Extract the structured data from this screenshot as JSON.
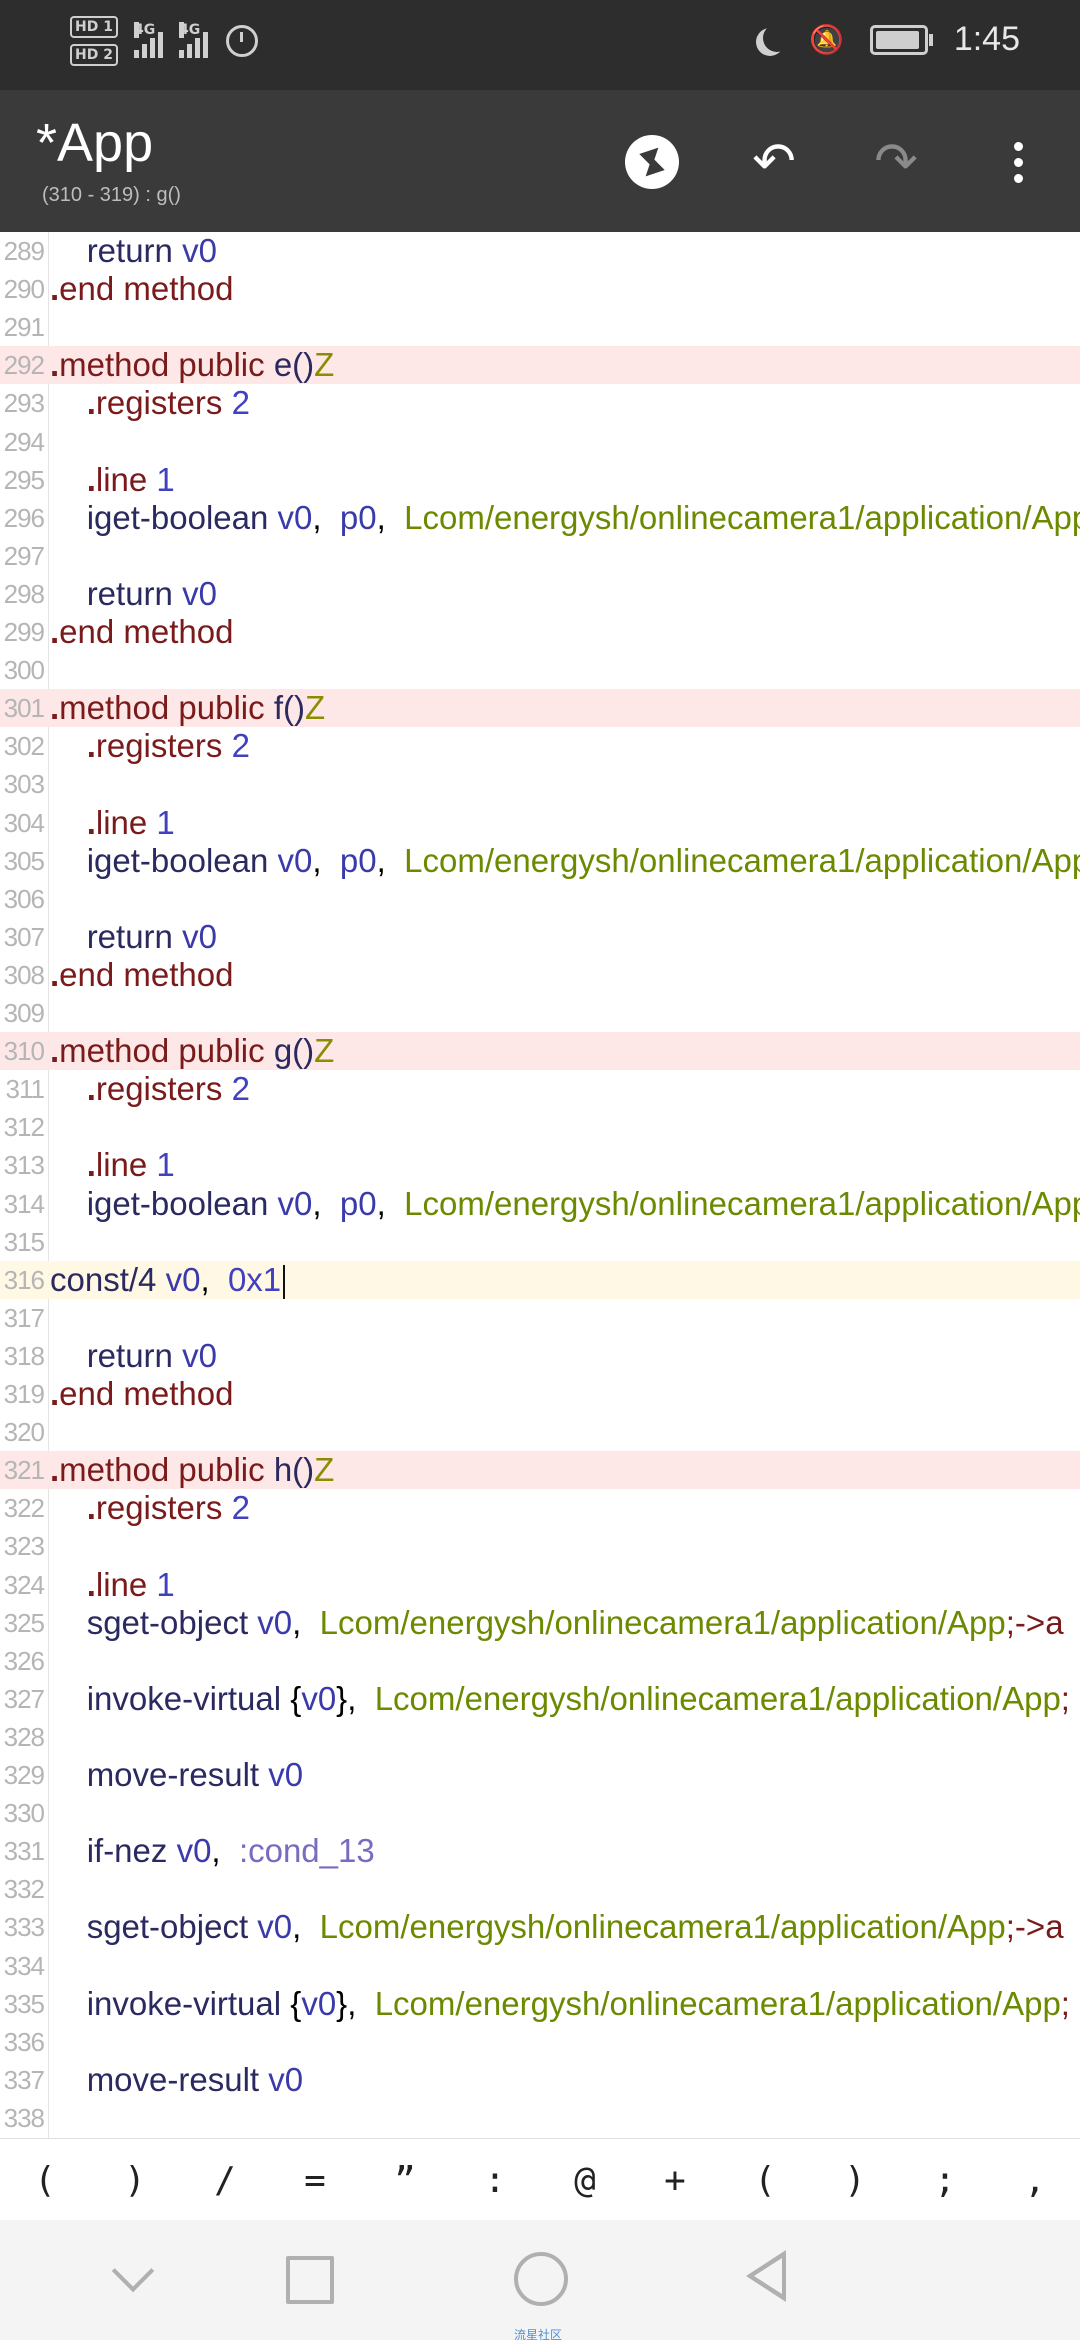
{
  "status_bar": {
    "hd1": "HD 1",
    "hd2": "HD 2",
    "net1": "4G",
    "net2": "4G",
    "time": "1:45"
  },
  "toolbar": {
    "title": "*App",
    "subtitle": "(310 - 319) : g()"
  },
  "editor": {
    "lines": [
      {
        "n": "289",
        "html": "    <span class='kw'>return</span> <span class='reg'>v0</span>"
      },
      {
        "n": "290",
        "html": "<span class='dot'>.</span><span class='dir'>end method</span>"
      },
      {
        "n": "291",
        "html": ""
      },
      {
        "n": "292",
        "html": "<span class='dot'>.</span><span class='dir'>method public</span> <span class='kw'>e()</span><span class='ty'>Z</span>",
        "cls": "method"
      },
      {
        "n": "293",
        "html": "    <span class='dot'>.</span><span class='dir'>registers</span> <span class='num'>2</span>"
      },
      {
        "n": "294",
        "html": ""
      },
      {
        "n": "295",
        "html": "    <span class='dot'>.</span><span class='dir'>line</span> <span class='num'>1</span>"
      },
      {
        "n": "296",
        "html": "    <span class='kw'>iget-boolean</span> <span class='reg'>v0</span>,  <span class='reg'>p0</span>,  <span class='cls'>Lcom/energysh/onlinecamera1/application/App</span>"
      },
      {
        "n": "297",
        "html": ""
      },
      {
        "n": "298",
        "html": "    <span class='kw'>return</span> <span class='reg'>v0</span>"
      },
      {
        "n": "299",
        "html": "<span class='dot'>.</span><span class='dir'>end method</span>"
      },
      {
        "n": "300",
        "html": ""
      },
      {
        "n": "301",
        "html": "<span class='dot'>.</span><span class='dir'>method public</span> <span class='kw'>f()</span><span class='ty'>Z</span>",
        "cls": "method"
      },
      {
        "n": "302",
        "html": "    <span class='dot'>.</span><span class='dir'>registers</span> <span class='num'>2</span>"
      },
      {
        "n": "303",
        "html": ""
      },
      {
        "n": "304",
        "html": "    <span class='dot'>.</span><span class='dir'>line</span> <span class='num'>1</span>"
      },
      {
        "n": "305",
        "html": "    <span class='kw'>iget-boolean</span> <span class='reg'>v0</span>,  <span class='reg'>p0</span>,  <span class='cls'>Lcom/energysh/onlinecamera1/application/App</span>"
      },
      {
        "n": "306",
        "html": ""
      },
      {
        "n": "307",
        "html": "    <span class='kw'>return</span> <span class='reg'>v0</span>"
      },
      {
        "n": "308",
        "html": "<span class='dot'>.</span><span class='dir'>end method</span>"
      },
      {
        "n": "309",
        "html": ""
      },
      {
        "n": "310",
        "html": "<span class='dot'>.</span><span class='dir'>method public</span> <span class='kw'>g()</span><span class='ty'>Z</span>",
        "cls": "method"
      },
      {
        "n": "311",
        "html": "    <span class='dot'>.</span><span class='dir'>registers</span> <span class='num'>2</span>"
      },
      {
        "n": "312",
        "html": ""
      },
      {
        "n": "313",
        "html": "    <span class='dot'>.</span><span class='dir'>line</span> <span class='num'>1</span>"
      },
      {
        "n": "314",
        "html": "    <span class='kw'>iget-boolean</span> <span class='reg'>v0</span>,  <span class='reg'>p0</span>,  <span class='cls'>Lcom/energysh/onlinecamera1/application/App</span>"
      },
      {
        "n": "315",
        "html": ""
      },
      {
        "n": "316",
        "html": "<span class='kw'>const/4</span> <span class='reg'>v0</span>,  <span class='num'>0x1</span><span class='caret'></span>",
        "cls": "current"
      },
      {
        "n": "317",
        "html": ""
      },
      {
        "n": "318",
        "html": "    <span class='kw'>return</span> <span class='reg'>v0</span>"
      },
      {
        "n": "319",
        "html": "<span class='dot'>.</span><span class='dir'>end method</span>"
      },
      {
        "n": "320",
        "html": ""
      },
      {
        "n": "321",
        "html": "<span class='dot'>.</span><span class='dir'>method public</span> <span class='kw'>h()</span><span class='ty'>Z</span>",
        "cls": "method"
      },
      {
        "n": "322",
        "html": "    <span class='dot'>.</span><span class='dir'>registers</span> <span class='num'>2</span>"
      },
      {
        "n": "323",
        "html": ""
      },
      {
        "n": "324",
        "html": "    <span class='dot'>.</span><span class='dir'>line</span> <span class='num'>1</span>"
      },
      {
        "n": "325",
        "html": "    <span class='kw'>sget-object</span> <span class='reg'>v0</span>,  <span class='cls'>Lcom/energysh/onlinecamera1/application/App</span><span class='dir'>;-&gt;a</span>"
      },
      {
        "n": "326",
        "html": ""
      },
      {
        "n": "327",
        "html": "    <span class='kw'>invoke-virtual</span> {<span class='reg'>v0</span>},  <span class='cls'>Lcom/energysh/onlinecamera1/application/App</span><span class='dir'>;</span>"
      },
      {
        "n": "328",
        "html": ""
      },
      {
        "n": "329",
        "html": "    <span class='kw'>move-result</span> <span class='reg'>v0</span>"
      },
      {
        "n": "330",
        "html": ""
      },
      {
        "n": "331",
        "html": "    <span class='kw'>if-nez</span> <span class='reg'>v0</span>,  <span class='lbl'>:cond_13</span>"
      },
      {
        "n": "332",
        "html": ""
      },
      {
        "n": "333",
        "html": "    <span class='kw'>sget-object</span> <span class='reg'>v0</span>,  <span class='cls'>Lcom/energysh/onlinecamera1/application/App</span><span class='dir'>;-&gt;a</span>"
      },
      {
        "n": "334",
        "html": ""
      },
      {
        "n": "335",
        "html": "    <span class='kw'>invoke-virtual</span> {<span class='reg'>v0</span>},  <span class='cls'>Lcom/energysh/onlinecamera1/application/App</span><span class='dir'>;</span>"
      },
      {
        "n": "336",
        "html": ""
      },
      {
        "n": "337",
        "html": "    <span class='kw'>move-result</span> <span class='reg'>v0</span>"
      },
      {
        "n": "338",
        "html": ""
      }
    ]
  },
  "symbols": [
    "(",
    ")",
    "/",
    "=",
    "”",
    ":",
    "@",
    "+",
    "(",
    ")",
    ";",
    ","
  ],
  "nav": {
    "watermark": "流星社区"
  }
}
